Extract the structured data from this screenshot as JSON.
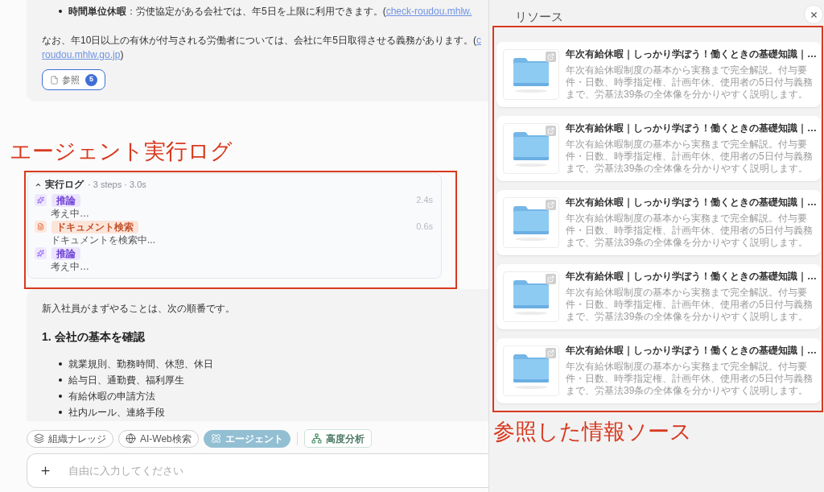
{
  "conversation_top": {
    "bullet": {
      "text": "**時間単位休暇**：労使協定がある会社では、年5日を上限に利用できます。(",
      "link": "check-roudou.mhlw."
    },
    "note": {
      "text": "なお、年10日以上の有休が付与される労働者については、会社に年5日取得させる義務があります。(",
      "link_parts": [
        "c",
        "roudou.mhlw.go.jp"
      ],
      "text_after": ")"
    },
    "reference_button": {
      "label": "参照",
      "count": "5"
    }
  },
  "annotations": [
    {
      "text": "エージェント実行ログ"
    },
    {
      "text": "参照した情報ソース"
    }
  ],
  "execution_log": {
    "expanded": true,
    "title": "実行ログ",
    "summary": "· 3 steps · 3.0s",
    "steps": [
      {
        "kind": "reasoning",
        "label": "推論",
        "time": "2.4s",
        "detail": "考え中…"
      },
      {
        "kind": "document_search",
        "label": "ドキュメント検索",
        "time": "0.6s",
        "detail": "ドキュメントを検索中..."
      },
      {
        "kind": "reasoning",
        "label": "推論",
        "detail": "考え中…"
      }
    ]
  },
  "conversation_bottom": {
    "intro": "新入社員がまずやることは、次の順番です。",
    "heading": "1. 会社の基本を確認",
    "bullets": [
      "就業規則、勤務時間、休憩、休日",
      "給与日、通勤費、福利厚生",
      "有給休暇の申請方法",
      "社内ルール、連絡手段"
    ]
  },
  "composer": {
    "chips": [
      {
        "kind": "knowledge",
        "label": "組織ナレッジ",
        "selected": false
      },
      {
        "kind": "web",
        "label": "AI-Web検索",
        "selected": false
      },
      {
        "kind": "agent",
        "label": "エージェント",
        "selected": true
      }
    ],
    "analysis_button": {
      "label": "高度分析"
    },
    "placeholder": "自由に入力してください"
  },
  "resources_panel": {
    "title": "リソース",
    "items": [
      {
        "title": "年次有給休暇｜しっかり学ぼう！働くときの基礎知識｜…",
        "description": "年次有給休暇制度の基本から実務まで完全解説。付与要件・日数、時季指定権、計画年休、使用者の5日付与義務まで、労基法39条の全体像を分かりやすく説明します。"
      },
      {
        "title": "年次有給休暇｜しっかり学ぼう！働くときの基礎知識｜…",
        "description": "年次有給休暇制度の基本から実務まで完全解説。付与要件・日数、時季指定権、計画年休、使用者の5日付与義務まで、労基法39条の全体像を分かりやすく説明します。"
      },
      {
        "title": "年次有給休暇｜しっかり学ぼう！働くときの基礎知識｜…",
        "description": "年次有給休暇制度の基本から実務まで完全解説。付与要件・日数、時季指定権、計画年休、使用者の5日付与義務まで、労基法39条の全体像を分かりやすく説明します。"
      },
      {
        "title": "年次有給休暇｜しっかり学ぼう！働くときの基礎知識｜…",
        "description": "年次有給休暇制度の基本から実務まで完全解説。付与要件・日数、時季指定権、計画年休、使用者の5日付与義務まで、労基法39条の全体像を分かりやすく説明します。"
      },
      {
        "title": "年次有給休暇｜しっかり学ぼう！働くときの基礎知識｜…",
        "description": "年次有給休暇制度の基本から実務まで完全解説。付与要件・日数、時季指定権、計画年休、使用者の5日付与義務まで、労基法39条の全体像を分かりやすく説明します。"
      }
    ]
  }
}
